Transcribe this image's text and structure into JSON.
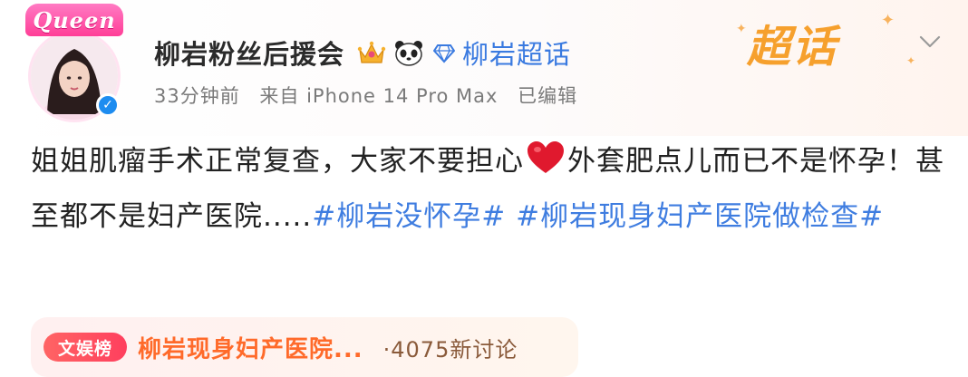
{
  "header": {
    "frame_text": "Queen",
    "username": "柳岩粉丝后援会",
    "supertopic_link": "柳岩超话",
    "time": "33分钟前",
    "source": "来自 iPhone 14 Pro Max",
    "edited": "已编辑",
    "logo_text": "超话",
    "icons": [
      "crown-icon",
      "panda-icon",
      "diamond-icon",
      "chevron-down-icon",
      "verified-icon"
    ]
  },
  "post": {
    "text_before_heart": "姐姐肌瘤手术正常复查，大家不要担心",
    "text_after_heart": "外套肥点儿而已不是怀孕！甚至都不是妇产医院.....",
    "hashtag1": "#柳岩没怀孕#",
    "hashtag2": "#柳岩现身妇产医院做检查#"
  },
  "topic_card": {
    "badge": "文娱榜",
    "title": "柳岩现身妇产医院...",
    "count": "·4075新讨论"
  },
  "colors": {
    "link_blue": "#3f7de0",
    "logo_orange": "#f6a02d",
    "topic_orange": "#ff6a2a",
    "badge_red": "#ff4a5e"
  }
}
